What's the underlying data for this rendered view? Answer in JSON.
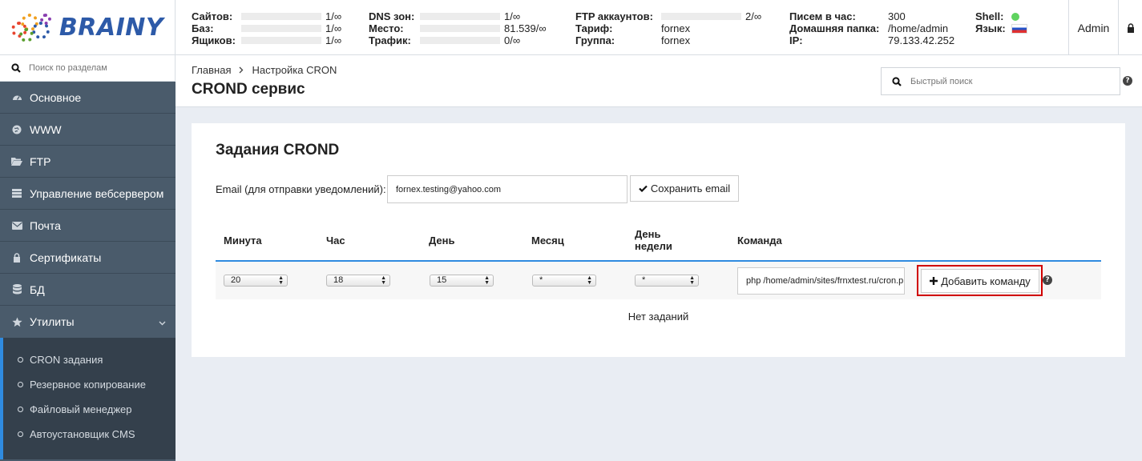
{
  "app": {
    "name": "BRAINY"
  },
  "stats": {
    "sites": {
      "label": "Сайтов:",
      "value": "1/∞"
    },
    "dbs": {
      "label": "Баз:",
      "value": "1/∞"
    },
    "mailboxes": {
      "label": "Ящиков:",
      "value": "1/∞"
    },
    "dns": {
      "label": "DNS зон:",
      "value": "1/∞"
    },
    "space": {
      "label": "Место:",
      "value": "81.539/∞"
    },
    "traffic": {
      "label": "Трафик:",
      "value": "0/∞"
    },
    "ftp": {
      "label": "FTP аккаунтов:",
      "value": "2/∞"
    },
    "tariff": {
      "label": "Тариф:",
      "value": "fornex"
    },
    "group": {
      "label": "Группа:",
      "value": "fornex"
    },
    "mails_per_hour": {
      "label": "Писем в час:",
      "value": "300"
    },
    "home": {
      "label": "Домашняя папка:",
      "value": "/home/admin"
    },
    "ip": {
      "label": "IP:",
      "value": "79.133.42.252"
    },
    "shell": {
      "label": "Shell:",
      "status_color": "#5fd35f"
    },
    "language": {
      "label": "Язык:",
      "flag": "ru-flag-icon"
    }
  },
  "user": {
    "name": "Admin"
  },
  "sidebar": {
    "search_placeholder": "Поиск по разделам",
    "items": [
      {
        "label": "Основное",
        "icon": "dashboard-icon"
      },
      {
        "label": "WWW",
        "icon": "globe-icon"
      },
      {
        "label": "FTP",
        "icon": "folder-open-icon"
      },
      {
        "label": "Управление вебсервером",
        "icon": "server-icon"
      },
      {
        "label": "Почта",
        "icon": "envelope-icon"
      },
      {
        "label": "Сертификаты",
        "icon": "lock-icon"
      },
      {
        "label": "БД",
        "icon": "database-icon"
      },
      {
        "label": "Утилиты",
        "icon": "star-icon"
      }
    ],
    "submenu": [
      {
        "label": "CRON задания"
      },
      {
        "label": "Резервное копирование"
      },
      {
        "label": "Файловый менеджер"
      },
      {
        "label": "Автоустановщик CMS"
      }
    ]
  },
  "breadcrumb": {
    "home": "Главная",
    "current": "Настройка CRON"
  },
  "page": {
    "title": "CROND сервис",
    "quick_search_placeholder": "Быстрый поиск"
  },
  "card": {
    "title": "Задания CROND",
    "email_label": "Email (для отправки уведомлений):",
    "email_value": "fornex.testing@yahoo.com",
    "save_email_label": "Сохранить email",
    "columns": {
      "minute": "Минута",
      "hour": "Час",
      "day": "День",
      "month": "Месяц",
      "weekday_line1": "День",
      "weekday_line2": "недели",
      "command": "Команда"
    },
    "new_row": {
      "minute": "20",
      "hour": "18",
      "day": "15",
      "month": "*",
      "weekday": "*",
      "command": "php /home/admin/sites/frnxtest.ru/cron.php"
    },
    "add_command_label": "Добавить команду",
    "empty_text": "Нет заданий"
  }
}
